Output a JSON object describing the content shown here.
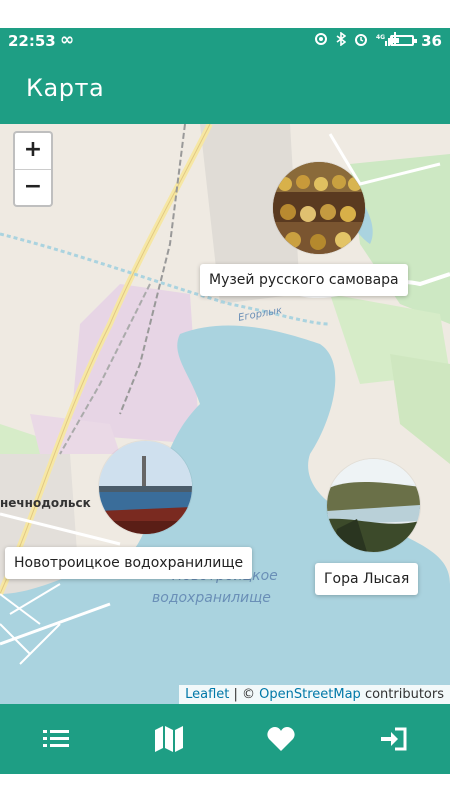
{
  "status_bar": {
    "time": "22:53",
    "infinity": "∞",
    "battery_level": "36",
    "battery_fraction": 0.36,
    "icons": [
      "sync-icon",
      "bluetooth-icon",
      "alarm-icon",
      "signal-icon",
      "battery-icon"
    ]
  },
  "app_bar": {
    "title": "Карта"
  },
  "map": {
    "zoom_in": "+",
    "zoom_out": "−",
    "water_label_1": "Новотроицкое",
    "water_label_2": "водохранилище",
    "town_label": "нечнодольск",
    "river_label": "Егорлык",
    "places": [
      {
        "label": "Музей русского самовара",
        "icon": "samovar-museum-photo"
      },
      {
        "label": "Новотроицкое водохранилище",
        "icon": "reservoir-photo"
      },
      {
        "label": "Гора Лысая",
        "icon": "mountain-photo"
      }
    ],
    "attribution": {
      "leaflet": "Leaflet",
      "separator": " | © ",
      "osm": "OpenStreetMap",
      "suffix": " contributors"
    }
  },
  "bottom_nav": {
    "items": [
      {
        "icon": "list-icon"
      },
      {
        "icon": "map-icon"
      },
      {
        "icon": "heart-icon"
      },
      {
        "icon": "login-icon"
      }
    ]
  },
  "colors": {
    "primary": "#1e9e84",
    "water": "#aad3df",
    "land": "#efeae2"
  }
}
